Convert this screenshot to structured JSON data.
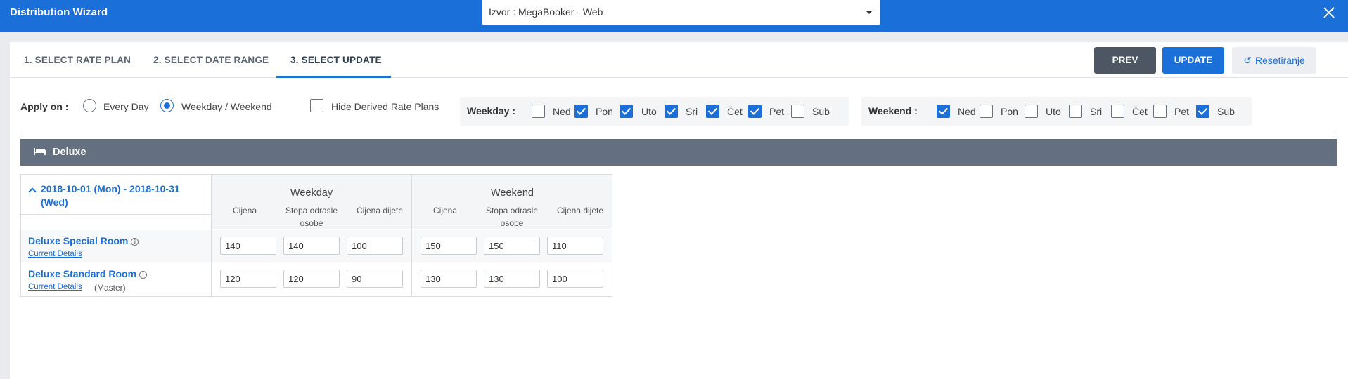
{
  "header": {
    "title": "Distribution Wizard",
    "source_value": "Izvor : MegaBooker - Web"
  },
  "tabs": [
    {
      "label": "1. SELECT RATE PLAN"
    },
    {
      "label": "2. SELECT DATE RANGE"
    },
    {
      "label": "3. SELECT UPDATE",
      "active": true
    }
  ],
  "actions": {
    "prev": "PREV",
    "update": "UPDATE",
    "reset": "Resetiranje",
    "reset_icon": "undo-icon"
  },
  "apply": {
    "label": "Apply on :",
    "options": [
      {
        "label": "Every Day",
        "selected": false
      },
      {
        "label": "Weekday / Weekend",
        "selected": true
      }
    ],
    "hide_derived": {
      "label": "Hide Derived Rate Plans",
      "checked": false
    }
  },
  "weekday": {
    "label": "Weekday :",
    "days": [
      {
        "label": "Ned",
        "checked": false
      },
      {
        "label": "Pon",
        "checked": true
      },
      {
        "label": "Uto",
        "checked": true
      },
      {
        "label": "Sri",
        "checked": true
      },
      {
        "label": "Čet",
        "checked": true
      },
      {
        "label": "Pet",
        "checked": true
      },
      {
        "label": "Sub",
        "checked": false
      }
    ]
  },
  "weekend": {
    "label": "Weekend :",
    "days": [
      {
        "label": "Ned",
        "checked": true
      },
      {
        "label": "Pon",
        "checked": false
      },
      {
        "label": "Uto",
        "checked": false
      },
      {
        "label": "Sri",
        "checked": false
      },
      {
        "label": "Čet",
        "checked": false
      },
      {
        "label": "Pet",
        "checked": false
      },
      {
        "label": "Sub",
        "checked": true
      }
    ]
  },
  "room_type": {
    "name": "Deluxe",
    "icon": "bed-icon"
  },
  "grid": {
    "date_range": "2018-10-01 (Mon)  -  2018-10-31 (Wed)",
    "groups": [
      "Weekday",
      "Weekend"
    ],
    "columns": [
      "Cijena",
      "Stopa odrasle osobe",
      "Cijena dijete"
    ],
    "rows": [
      {
        "name": "Deluxe Special Room",
        "details_link": "Current Details",
        "note": "",
        "values": [
          "140",
          "140",
          "100",
          "150",
          "150",
          "110"
        ]
      },
      {
        "name": "Deluxe Standard Room",
        "details_link": "Current Details",
        "note": "(Master)",
        "values": [
          "120",
          "120",
          "90",
          "130",
          "130",
          "100"
        ]
      }
    ]
  }
}
